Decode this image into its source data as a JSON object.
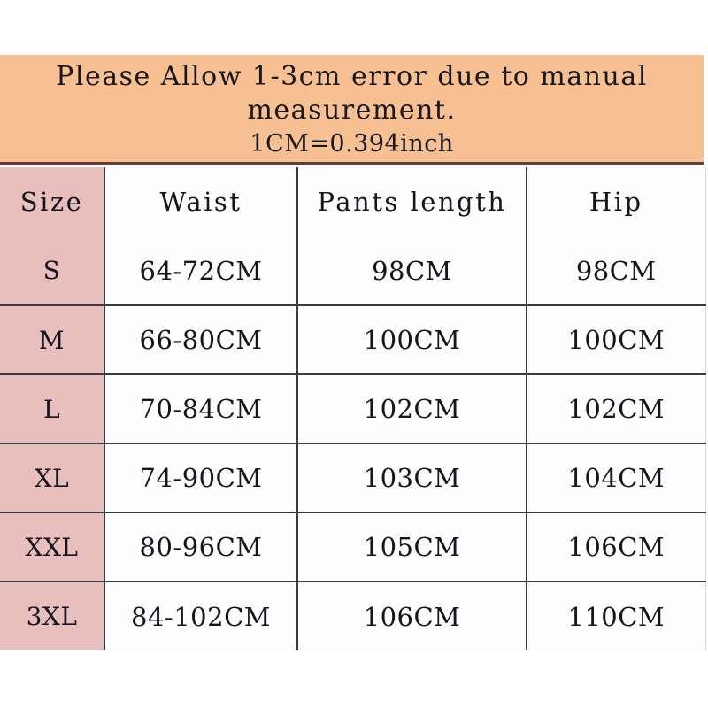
{
  "notice": {
    "line1": "Please Allow 1-3cm error due to manual",
    "line2": "measurement.",
    "line3": "1CM=0.394inch"
  },
  "colors": {
    "banner_background": "#f7c093",
    "banner_border": "#6b3b33",
    "size_column_background": "#e8bfbd",
    "cell_background": "#fefdfd",
    "grid_line": "#3a3a42",
    "text": "#15151f"
  },
  "chart_data": {
    "type": "table",
    "title": "Please Allow 1-3cm error due to manual measurement.",
    "subtitle": "1CM=0.394inch",
    "columns": [
      "Size",
      "Waist",
      "Pants length",
      "Hip"
    ],
    "rows": [
      {
        "size": "S",
        "waist": "64-72CM",
        "pants_length": "98CM",
        "hip": "98CM"
      },
      {
        "size": "M",
        "waist": "66-80CM",
        "pants_length": "100CM",
        "hip": "100CM"
      },
      {
        "size": "L",
        "waist": "70-84CM",
        "pants_length": "102CM",
        "hip": "102CM"
      },
      {
        "size": "XL",
        "waist": "74-90CM",
        "pants_length": "103CM",
        "hip": "104CM"
      },
      {
        "size": "XXL",
        "waist": "80-96CM",
        "pants_length": "105CM",
        "hip": "106CM"
      },
      {
        "size": "3XL",
        "waist": "84-102CM",
        "pants_length": "106CM",
        "hip": "110CM"
      }
    ]
  }
}
